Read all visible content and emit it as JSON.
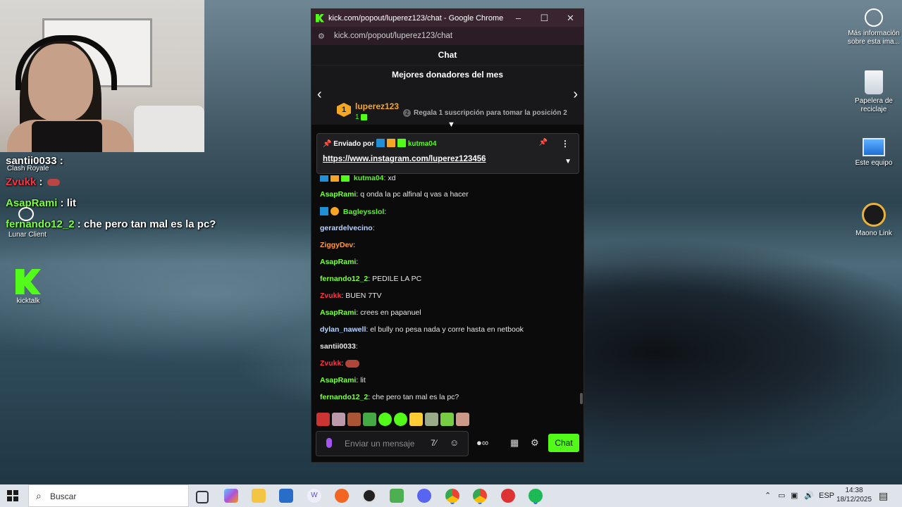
{
  "overlay_chat": [
    {
      "user": "santii0033",
      "sep": " :",
      "text": "",
      "user_color": "#ffffff",
      "emote": false
    },
    {
      "user": "Zvukk",
      "sep": " :",
      "text": "",
      "user_color": "#ff3344",
      "emote": true
    },
    {
      "user": "AsapRami",
      "sep": " :",
      "text": "lit",
      "user_color": "#7cff3f",
      "emote": false
    },
    {
      "user": "fernando12_2",
      "sep": " :",
      "text": "che pero tan mal es la pc?",
      "user_color": "#7cff3f",
      "emote": false
    }
  ],
  "desktop_labels": {
    "clash": "Clash Royale",
    "lunar": "Lunar Client",
    "kicktalk": "kicktalk"
  },
  "desktop_icons": {
    "info": "Más información sobre esta ima...",
    "recycle": "Papelera de reciclaje",
    "thispc": "Este equipo",
    "maono": "Maono Link"
  },
  "window": {
    "title": "kick.com/popout/luperez123/chat - Google Chrome",
    "url": "kick.com/popout/luperez123/chat"
  },
  "chat": {
    "header": "Chat",
    "donors_title": "Mejores donadores del mes",
    "top_donor": {
      "rank": "1",
      "name": "luperez123",
      "count": "1"
    },
    "gift_rank": "2",
    "gift_text": "Regala 1 suscripción para tomar la posición 2",
    "pinned": {
      "by_label": "Enviado por",
      "user": "kutma04",
      "link": "https://www.instagram.com/luperez123456"
    },
    "messages": [
      {
        "user": "kutma04",
        "sep": ":",
        "text": " xd",
        "color": "#53fc18",
        "badges": [
          "blue",
          "gold",
          "green"
        ],
        "emote": false
      },
      {
        "user": "AsapRami",
        "sep": ":",
        "text": " q onda la pc alfinal q vas a hacer",
        "color": "#7cff3f",
        "badges": [],
        "emote": false
      },
      {
        "user": "Bagleysslol",
        "sep": ":",
        "text": "",
        "color": "#53fc18",
        "badges": [
          "blue",
          "round-gold"
        ],
        "emote": false
      },
      {
        "user": "gerardelvecino",
        "sep": ":",
        "text": "",
        "color": "#b8d4ff",
        "badges": [],
        "emote": false
      },
      {
        "user": "ZiggyDev",
        "sep": ":",
        "text": "",
        "color": "#ff9a3c",
        "badges": [],
        "emote": false
      },
      {
        "user": "AsapRami",
        "sep": ":",
        "text": "",
        "color": "#7cff3f",
        "badges": [],
        "emote": false
      },
      {
        "user": "fernando12_2",
        "sep": ":",
        "text": " PEDILE LA PC",
        "color": "#7cff3f",
        "badges": [],
        "emote": false
      },
      {
        "user": "Zvukk",
        "sep": ":",
        "text": "  BUEN 7TV",
        "color": "#ff3344",
        "badges": [],
        "emote": false
      },
      {
        "user": "AsapRami",
        "sep": ":",
        "text": " crees en papanuel",
        "color": "#7cff3f",
        "badges": [],
        "emote": false
      },
      {
        "user": "dylan_nawell",
        "sep": ":",
        "text": " el bully no pesa nada y corre hasta en netbook",
        "color": "#b8d4ff",
        "badges": [],
        "emote": false
      },
      {
        "user": "santii0033",
        "sep": ":",
        "text": "",
        "color": "#e6e6e6",
        "badges": [],
        "emote": false
      },
      {
        "user": "Zvukk",
        "sep": ":",
        "text": " ",
        "color": "#ff3344",
        "badges": [],
        "emote": true
      },
      {
        "user": "AsapRami",
        "sep": ":",
        "text": " lit",
        "color": "#7cff3f",
        "badges": [],
        "emote": false
      },
      {
        "user": "fernando12_2",
        "sep": ":",
        "text": " che pero tan mal es la pc?",
        "color": "#7cff3f",
        "badges": [],
        "emote": false
      }
    ],
    "emote_colors": [
      "#c33",
      "#b9a",
      "#a53",
      "#4a4",
      "#53fc18",
      "#53fc18",
      "#fc3",
      "#9a8",
      "#7c4",
      "#c98"
    ],
    "input_placeholder": "Enviar un mensaje",
    "send_label": "Chat"
  },
  "taskbar": {
    "search_placeholder": "Buscar",
    "lang": "ESP",
    "time": "14:38",
    "date": "18/12/2025",
    "apps": [
      "task-view",
      "copilot",
      "file-explorer",
      "store",
      "wps",
      "orange-app",
      "obs",
      "minecraft",
      "discord",
      "chrome",
      "chrome-active",
      "red-app",
      "spotify"
    ]
  }
}
